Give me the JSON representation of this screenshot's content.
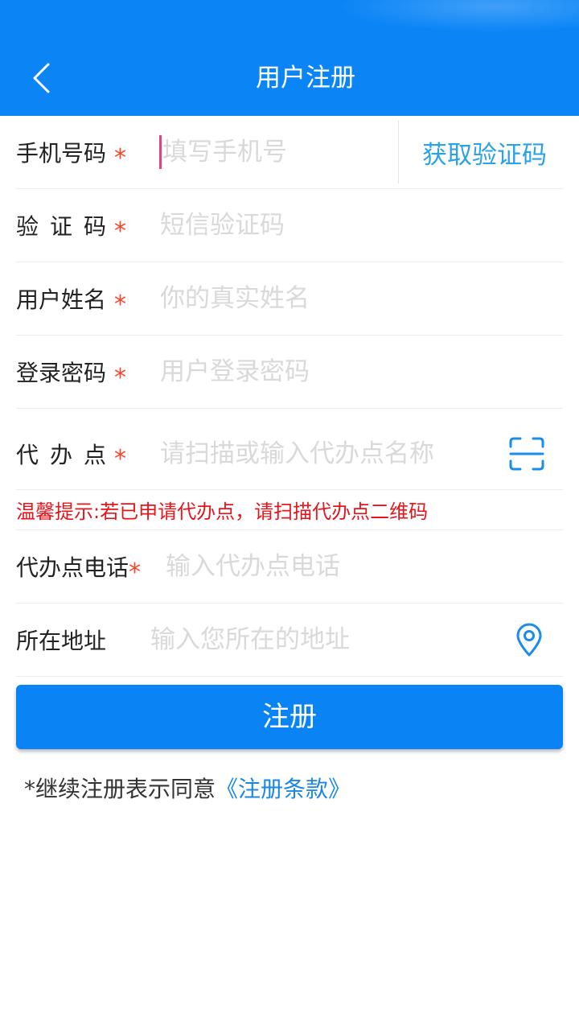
{
  "header": {
    "title": "用户注册",
    "back_icon": "chevron-left-icon"
  },
  "form": {
    "phone": {
      "label": "手机号码",
      "required_mark": "*",
      "placeholder": "填写手机号",
      "value": ""
    },
    "get_code_button": "获取验证码",
    "sms_code": {
      "label": "验 证 码",
      "required_mark": "*",
      "placeholder": "短信验证码",
      "value": ""
    },
    "real_name": {
      "label": "用户姓名",
      "required_mark": "*",
      "placeholder": "你的真实姓名",
      "value": ""
    },
    "password": {
      "label": "登录密码",
      "required_mark": "*",
      "placeholder": "用户登录密码",
      "value": ""
    },
    "agent_point": {
      "label": "代 办 点",
      "required_mark": "*",
      "placeholder": "请扫描或输入代办点名称",
      "value": "",
      "action_icon": "scan-icon"
    },
    "tip": "温馨提示:若已申请代办点，请扫描代办点二维码",
    "agent_phone": {
      "label": "代办点电话",
      "required_mark": "*",
      "placeholder": "输入代办点电话",
      "value": ""
    },
    "address": {
      "label": "所在地址",
      "placeholder": "输入您所在的地址",
      "value": "",
      "action_icon": "location-pin-icon"
    }
  },
  "register_button": "注册",
  "footer": {
    "prefix": "*继续注册表示同意",
    "terms_link": "《注册条款》"
  },
  "colors": {
    "header_bg": "#0B85F6",
    "primary_button": "#0A84F5",
    "get_code_text": "#2AA2E6",
    "link": "#1A87E6",
    "icon": "#1A8CEB",
    "required_mark": "#F2472B",
    "tip_text": "#E8141C",
    "placeholder": "#D9D9D9",
    "caret": "#E8407A"
  }
}
